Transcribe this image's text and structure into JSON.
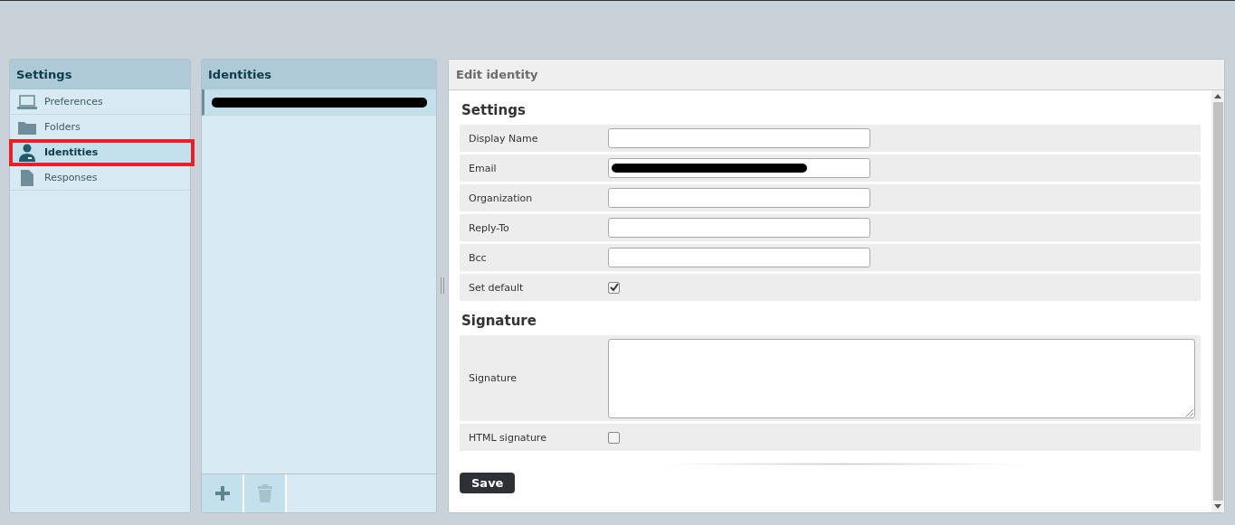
{
  "sidebar": {
    "title": "Settings",
    "items": [
      {
        "label": "Preferences",
        "kind": "laptop",
        "selected": false,
        "highlighted": false
      },
      {
        "label": "Folders",
        "kind": "folder",
        "selected": false,
        "highlighted": false
      },
      {
        "label": "Identities",
        "kind": "person",
        "selected": true,
        "highlighted": true
      },
      {
        "label": "Responses",
        "kind": "document",
        "selected": false,
        "highlighted": false
      }
    ]
  },
  "identities": {
    "title": "Identities",
    "items": [
      {
        "redacted": true,
        "selected": true
      }
    ]
  },
  "editor": {
    "title": "Edit identity",
    "sections": [
      {
        "title": "Settings",
        "fields": [
          {
            "kind": "text",
            "label": "Display Name",
            "redacted": false
          },
          {
            "kind": "text",
            "label": "Email",
            "redacted": true
          },
          {
            "kind": "text",
            "label": "Organization",
            "redacted": false
          },
          {
            "kind": "text",
            "label": "Reply-To",
            "redacted": false
          },
          {
            "kind": "text",
            "label": "Bcc",
            "redacted": false
          },
          {
            "kind": "checkbox",
            "label": "Set default",
            "checked": true
          }
        ]
      },
      {
        "title": "Signature",
        "fields": [
          {
            "kind": "textarea",
            "label": "Signature",
            "redacted": false
          },
          {
            "kind": "checkbox",
            "label": "HTML signature",
            "checked": false
          }
        ]
      }
    ],
    "save_label": "Save"
  }
}
